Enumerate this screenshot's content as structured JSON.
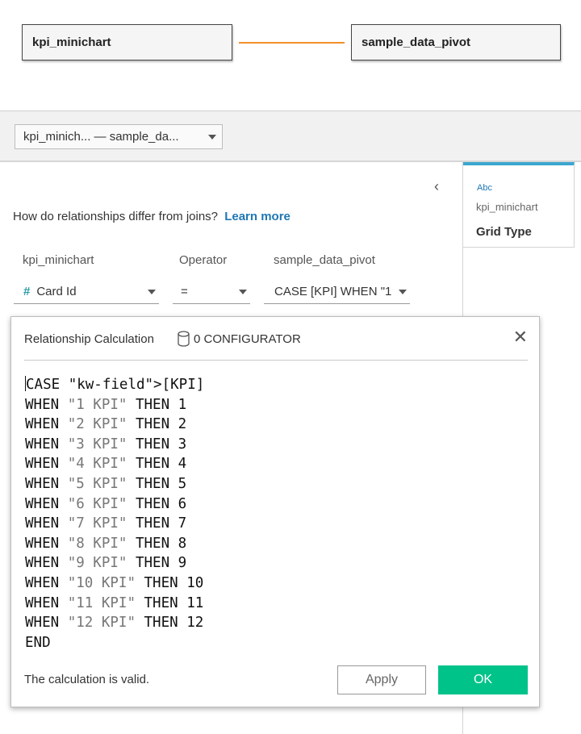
{
  "canvas": {
    "left_table": "kpi_minichart",
    "right_table": "sample_data_pivot",
    "line_color": "#f28e2b"
  },
  "toolbar": {
    "relationship_selector": "kpi_minich...  —  sample_da..."
  },
  "relationship_panel": {
    "help_text": "How do relationships differ from joins?",
    "learn_more": "Learn more",
    "headers": {
      "left": "kpi_minichart",
      "operator": "Operator",
      "right": "sample_data_pivot"
    },
    "left_field": "Card Id",
    "operator_value": "=",
    "right_field": "CASE [KPI] WHEN \"1"
  },
  "field_card": {
    "type": "Abc",
    "table": "kpi_minichart",
    "name": "Grid Type"
  },
  "dialog": {
    "title": "Relationship Calculation",
    "datasource": "0 CONFIGURATOR",
    "code": [
      "CASE [KPI]",
      "WHEN \"1 KPI\" THEN 1",
      "WHEN \"2 KPI\" THEN 2",
      "WHEN \"3 KPI\" THEN 3",
      "WHEN \"4 KPI\" THEN 4",
      "WHEN \"5 KPI\" THEN 5",
      "WHEN \"6 KPI\" THEN 6",
      "WHEN \"7 KPI\" THEN 7",
      "WHEN \"8 KPI\" THEN 8",
      "WHEN \"9 KPI\" THEN 9",
      "WHEN \"10 KPI\" THEN 10",
      "WHEN \"11 KPI\" THEN 11",
      "WHEN \"12 KPI\" THEN 12",
      "END"
    ],
    "status": "The calculation is valid.",
    "apply_label": "Apply",
    "ok_label": "OK"
  },
  "colors": {
    "accent": "#00c389",
    "field_highlight": "#f28e2b",
    "link": "#1f77b4"
  }
}
